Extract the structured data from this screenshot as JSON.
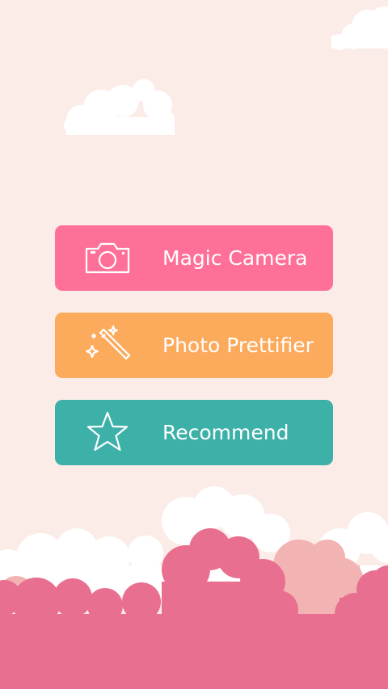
{
  "background": {
    "color": "#fcece8",
    "cloud_white": "#ffffff",
    "hill_pink": "#e96f90",
    "hill_light_pink": "#f2b3b3"
  },
  "menu": {
    "items": [
      {
        "label": "Magic Camera",
        "icon": "camera-icon",
        "color": "#ff7098"
      },
      {
        "label": "Photo Prettifier",
        "icon": "magic-wand-icon",
        "color": "#fcaa5c"
      },
      {
        "label": "Recommend",
        "icon": "star-icon",
        "color": "#3db0a8"
      }
    ]
  }
}
